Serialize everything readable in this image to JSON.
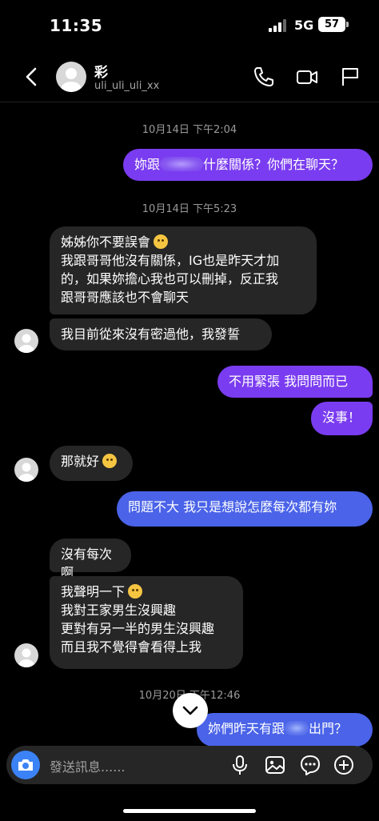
{
  "status_bar": {
    "time": "11:35",
    "network": "5G",
    "battery": "57"
  },
  "header": {
    "name": "彩",
    "username": "uli_uli_uli_xx"
  },
  "messages": {
    "ts1": "10月14日 下午2:04",
    "m1_before": "妳跟",
    "m1_after": "什麼關係？你們在聊天？",
    "ts2": "10月14日 下午5:23",
    "m2_line1": "姊姊你不要誤會",
    "m2_line2": "我跟哥哥他沒有關係，IG也是昨天才加",
    "m2_line3": "的，如果妳擔心我也可以刪掉，反正我",
    "m2_line4": "跟哥哥應該也不會聊天",
    "m3": "我目前從來沒有密過他，我發誓",
    "m4": "不用緊張 我問問而已",
    "m5": "沒事！",
    "m6": "那就好",
    "m7": "問題不大 我只是想說怎麼每次都有妳",
    "m8": "沒有每次啊",
    "m9_line1": "我聲明一下",
    "m9_line2": "我對王家男生沒興趣",
    "m9_line3": "更對有另一半的男生沒興趣",
    "m9_line4": "而且我不覺得會看得上我",
    "ts3": "10月20日 下午12:46",
    "m10_before": "妳們昨天有跟",
    "m10_after": "出門？"
  },
  "input": {
    "placeholder": "發送訊息......"
  },
  "colors": {
    "outgoing": "#7a3cf0",
    "outgoing_blue": "#4a63e8",
    "incoming": "#262626",
    "camera": "#3b82f6"
  },
  "icons": [
    "back-icon",
    "phone-icon",
    "video-icon",
    "flag-icon",
    "camera-icon",
    "microphone-icon",
    "image-icon",
    "sticker-icon",
    "plus-icon",
    "chevron-down-icon"
  ]
}
